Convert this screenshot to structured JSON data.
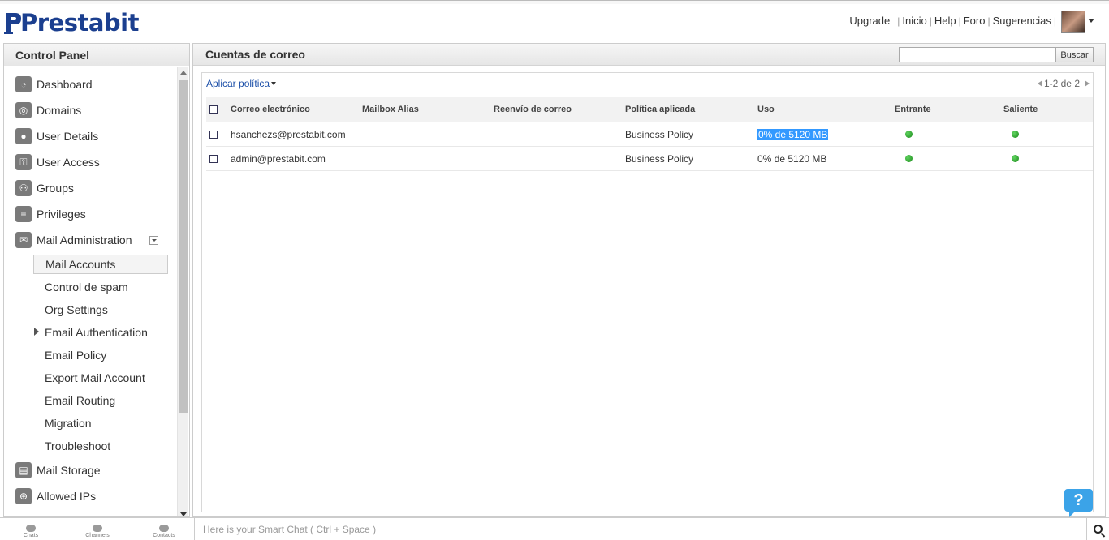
{
  "brand": {
    "name": "Prestabit",
    "color": "#1b3f8f"
  },
  "toplinks": {
    "upgrade": "Upgrade",
    "items": [
      "Inicio",
      "Help",
      "Foro",
      "Sugerencias"
    ]
  },
  "sidebar": {
    "title": "Control Panel",
    "items": [
      {
        "label": "Dashboard",
        "icon": "dashboard-icon"
      },
      {
        "label": "Domains",
        "icon": "globe-icon"
      },
      {
        "label": "User Details",
        "icon": "user-icon"
      },
      {
        "label": "User Access",
        "icon": "user-access-icon"
      },
      {
        "label": "Groups",
        "icon": "groups-icon"
      },
      {
        "label": "Privileges",
        "icon": "document-icon"
      },
      {
        "label": "Mail Administration",
        "icon": "envelope-icon"
      }
    ],
    "mail_sub": [
      {
        "label": "Mail Accounts",
        "active": true
      },
      {
        "label": "Control de spam"
      },
      {
        "label": "Org Settings"
      },
      {
        "label": "Email Authentication",
        "expandable": true
      },
      {
        "label": "Email Policy"
      },
      {
        "label": "Export Mail Account"
      },
      {
        "label": "Email Routing"
      },
      {
        "label": "Migration"
      },
      {
        "label": "Troubleshoot"
      }
    ],
    "items_after": [
      {
        "label": "Mail Storage",
        "icon": "storage-icon"
      },
      {
        "label": "Allowed IPs",
        "icon": "ip-icon"
      }
    ]
  },
  "main": {
    "title": "Cuentas de correo",
    "search": {
      "value": "",
      "button": "Buscar"
    },
    "apply_policy": "Aplicar política",
    "pager": "1-2 de 2",
    "columns": [
      "Correo electrónico",
      "Mailbox Alias",
      "Reenvío de correo",
      "Política aplicada",
      "Uso",
      "Entrante",
      "Saliente"
    ],
    "rows": [
      {
        "email": "hsanchezs@prestabit.com",
        "alias": "",
        "forward": "",
        "policy": "Business Policy",
        "usage": "0% de 5120 MB",
        "incoming": "enabled",
        "outgoing": "enabled"
      },
      {
        "email": "admin@prestabit.com",
        "alias": "",
        "forward": "",
        "policy": "Business Policy",
        "usage": "0% de 5120 MB",
        "incoming": "enabled",
        "outgoing": "enabled"
      }
    ]
  },
  "help": {
    "label": "?"
  },
  "bottombar": {
    "tabs": [
      "Chats",
      "Channels",
      "Contacts"
    ],
    "chat_placeholder": "Here is your Smart Chat ( Ctrl + Space )"
  }
}
